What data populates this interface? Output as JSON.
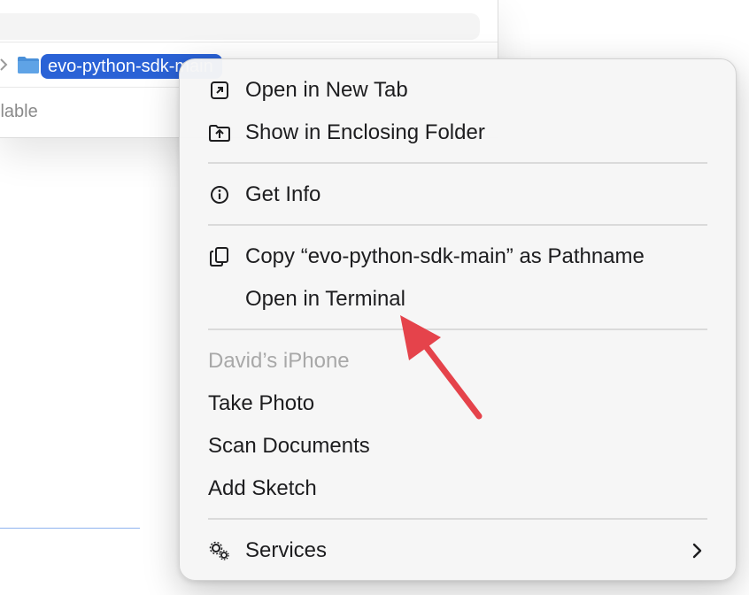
{
  "finder": {
    "path_folder": "evo-python-sdk-main",
    "status_text": "ilable"
  },
  "menu": {
    "items": [
      {
        "label": "Open in New Tab",
        "icon": "open-new-tab-icon"
      },
      {
        "label": "Show in Enclosing Folder",
        "icon": "enclosing-folder-icon"
      },
      {
        "label": "Get Info",
        "icon": "info-icon"
      },
      {
        "label": "Copy “evo-python-sdk-main” as Pathname",
        "icon": "copy-pathname-icon"
      },
      {
        "label": "Open in Terminal"
      },
      {
        "label": "David’s iPhone",
        "disabled": true
      },
      {
        "label": "Take Photo"
      },
      {
        "label": "Scan Documents"
      },
      {
        "label": "Add Sketch"
      },
      {
        "label": "Services",
        "icon": "gears-icon",
        "submenu": true
      }
    ]
  },
  "colors": {
    "selection": "#2a62d6",
    "annotation_arrow": "#e5434b",
    "menu_bg": "#f6f6f6"
  }
}
